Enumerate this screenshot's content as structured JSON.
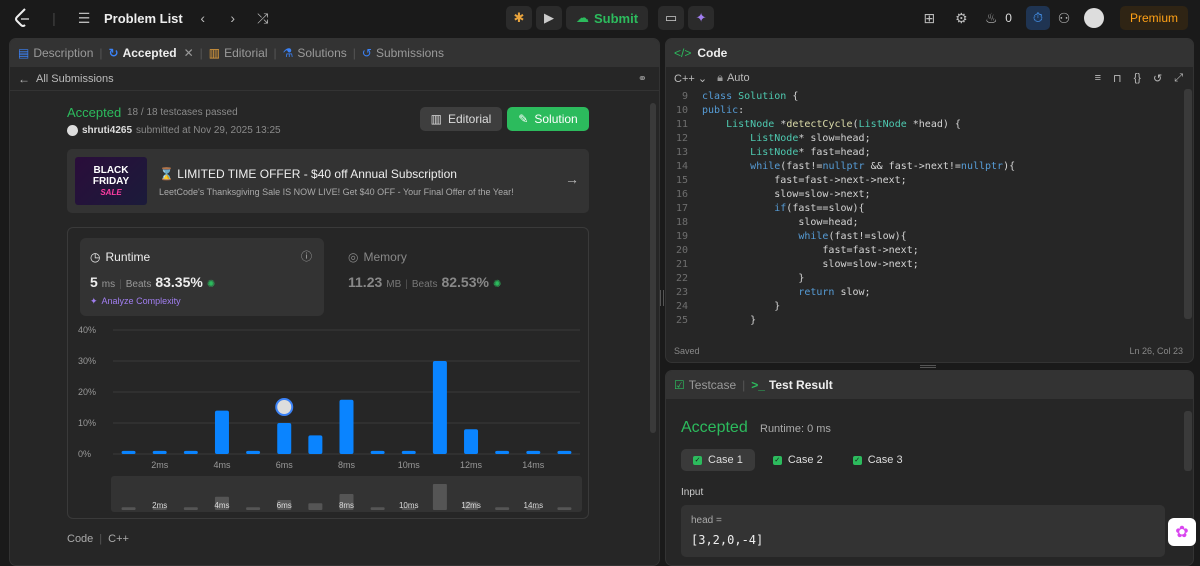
{
  "topbar": {
    "problem_list": "Problem List",
    "submit": "Submit",
    "streak": "0",
    "premium": "Premium"
  },
  "left_tabs": [
    {
      "label": "Description",
      "active": false
    },
    {
      "label": "Accepted",
      "active": true
    },
    {
      "label": "Editorial",
      "active": false
    },
    {
      "label": "Solutions",
      "active": false
    },
    {
      "label": "Submissions",
      "active": false
    }
  ],
  "all_submissions": "All Submissions",
  "result": {
    "status": "Accepted",
    "testcases": "18 / 18 testcases passed",
    "user": "shruti4265",
    "submitted": "submitted at Nov 29, 2025 13:25",
    "editorial_btn": "Editorial",
    "solution_btn": "Solution"
  },
  "promo": {
    "img_line1": "BLACK",
    "img_line2": "FRIDAY",
    "img_line3": "SALE",
    "title": "⌛ LIMITED TIME OFFER - $40 off Annual Subscription",
    "desc": "LeetCode's Thanksgiving Sale IS NOW LIVE! Get $40 OFF - Your Final Offer of the Year!"
  },
  "runtime": {
    "title": "Runtime",
    "value": "5",
    "unit": "ms",
    "beats_label": "Beats",
    "beats": "83.35%",
    "analyze": "Analyze Complexity"
  },
  "memory": {
    "title": "Memory",
    "value": "11.23",
    "unit": "MB",
    "beats_label": "Beats",
    "beats": "82.53%"
  },
  "chart_data": {
    "type": "bar",
    "categories": [
      "1ms",
      "2ms",
      "3ms",
      "4ms",
      "5ms",
      "6ms",
      "7ms",
      "8ms",
      "9ms",
      "10ms",
      "11ms",
      "12ms",
      "13ms",
      "14ms",
      "15ms"
    ],
    "values": [
      1,
      1,
      1,
      14,
      1,
      10,
      6,
      17.5,
      1,
      1,
      30,
      8,
      1,
      1,
      1
    ],
    "ylim": [
      0,
      40
    ],
    "yticks": [
      "0%",
      "10%",
      "20%",
      "30%",
      "40%"
    ],
    "xtick_labels": [
      "2ms",
      "4ms",
      "6ms",
      "8ms",
      "10ms",
      "12ms",
      "14ms"
    ],
    "highlight_index": 5,
    "bar_color": "#0a84ff",
    "overview_values": [
      1,
      1,
      1,
      14,
      1,
      10,
      6,
      17.5,
      1,
      1,
      30,
      8,
      1,
      1,
      1
    ],
    "overview_labels": [
      "2ms",
      "4ms",
      "6ms",
      "8ms",
      "10ms",
      "12ms",
      "14ms"
    ]
  },
  "bottom": {
    "code_label": "Code",
    "lang": "C++"
  },
  "code_panel": {
    "title": "Code",
    "lang": "C++",
    "auto": "Auto",
    "saved": "Saved",
    "cursor": "Ln 26, Col 23",
    "lines": [
      {
        "n": "9",
        "t": "class Solution {"
      },
      {
        "n": "10",
        "t": "public:"
      },
      {
        "n": "11",
        "t": "    ListNode *detectCycle(ListNode *head) {"
      },
      {
        "n": "12",
        "t": "        ListNode* slow=head;"
      },
      {
        "n": "13",
        "t": "        ListNode* fast=head;"
      },
      {
        "n": "14",
        "t": "        while(fast!=nullptr && fast->next!=nullptr){"
      },
      {
        "n": "15",
        "t": "            fast=fast->next->next;"
      },
      {
        "n": "16",
        "t": "            slow=slow->next;"
      },
      {
        "n": "17",
        "t": "            if(fast==slow){"
      },
      {
        "n": "18",
        "t": "                slow=head;"
      },
      {
        "n": "19",
        "t": "                while(fast!=slow){"
      },
      {
        "n": "20",
        "t": "                    fast=fast->next;"
      },
      {
        "n": "21",
        "t": "                    slow=slow->next;"
      },
      {
        "n": "22",
        "t": "                }"
      },
      {
        "n": "23",
        "t": "                return slow;"
      },
      {
        "n": "24",
        "t": "            }"
      },
      {
        "n": "25",
        "t": "        }"
      }
    ]
  },
  "test_panel": {
    "testcase_tab": "Testcase",
    "result_tab": "Test Result",
    "status": "Accepted",
    "runtime": "Runtime: 0 ms",
    "cases": [
      "Case 1",
      "Case 2",
      "Case 3"
    ],
    "input_label": "Input",
    "var": "head =",
    "value": "[3,2,0,-4]"
  }
}
